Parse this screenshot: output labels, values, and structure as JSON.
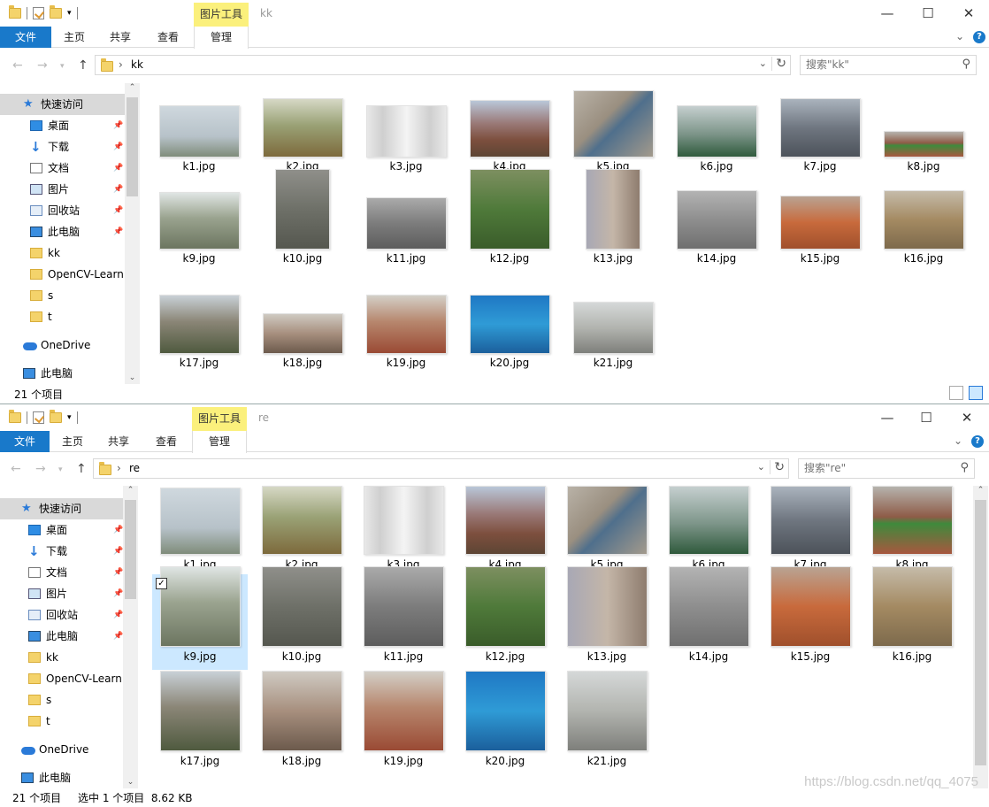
{
  "colors": {
    "accent": "#1979ca",
    "context_tab": "#fbf07c",
    "selected": "#cce8ff"
  },
  "ribbon": {
    "file": "文件",
    "home": "主页",
    "share": "共享",
    "view": "查看",
    "manage": "管理",
    "context": "图片工具"
  },
  "nav_pane": [
    {
      "label": "快速访问",
      "icon": "star-icon",
      "pinned": false
    },
    {
      "label": "桌面",
      "icon": "desktop-icon",
      "pinned": true
    },
    {
      "label": "下载",
      "icon": "download-icon",
      "pinned": true
    },
    {
      "label": "文档",
      "icon": "document-icon",
      "pinned": true
    },
    {
      "label": "图片",
      "icon": "picture-icon",
      "pinned": true
    },
    {
      "label": "回收站",
      "icon": "recycle-bin-icon",
      "pinned": true
    },
    {
      "label": "此电脑",
      "icon": "computer-icon",
      "pinned": true
    },
    {
      "label": "kk",
      "icon": "folder-icon",
      "pinned": false
    },
    {
      "label": "OpenCV-Learn",
      "icon": "folder-icon",
      "pinned": false
    },
    {
      "label": "s",
      "icon": "folder-icon",
      "pinned": false
    },
    {
      "label": "t",
      "icon": "folder-icon",
      "pinned": false
    },
    {
      "label": "OneDrive",
      "icon": "onedrive-icon",
      "pinned": false
    },
    {
      "label": "此电脑",
      "icon": "computer-icon",
      "pinned": false
    }
  ],
  "windows": [
    {
      "title": "kk",
      "path": "kk",
      "search_placeholder": "搜索\"kk\"",
      "status": "21 个项目",
      "selection": "",
      "files": [
        "k1.jpg",
        "k2.jpg",
        "k3.jpg",
        "k4.jpg",
        "k5.jpg",
        "k6.jpg",
        "k7.jpg",
        "k8.jpg",
        "k9.jpg",
        "k10.jpg",
        "k11.jpg",
        "k12.jpg",
        "k13.jpg",
        "k14.jpg",
        "k15.jpg",
        "k16.jpg",
        "k17.jpg",
        "k18.jpg",
        "k19.jpg",
        "k20.jpg",
        "k21.jpg"
      ],
      "selected_index": -1
    },
    {
      "title": "re",
      "path": "re",
      "search_placeholder": "搜索\"re\"",
      "status": "21 个项目",
      "selection": "选中 1 个项目  8.62 KB",
      "files": [
        "k1.jpg",
        "k2.jpg",
        "k3.jpg",
        "k4.jpg",
        "k5.jpg",
        "k6.jpg",
        "k7.jpg",
        "k8.jpg",
        "k9.jpg",
        "k10.jpg",
        "k11.jpg",
        "k12.jpg",
        "k13.jpg",
        "k14.jpg",
        "k15.jpg",
        "k16.jpg",
        "k17.jpg",
        "k18.jpg",
        "k19.jpg",
        "k20.jpg",
        "k21.jpg"
      ],
      "selected_index": 8
    }
  ],
  "watermark": "https://blog.csdn.net/qq_4075"
}
